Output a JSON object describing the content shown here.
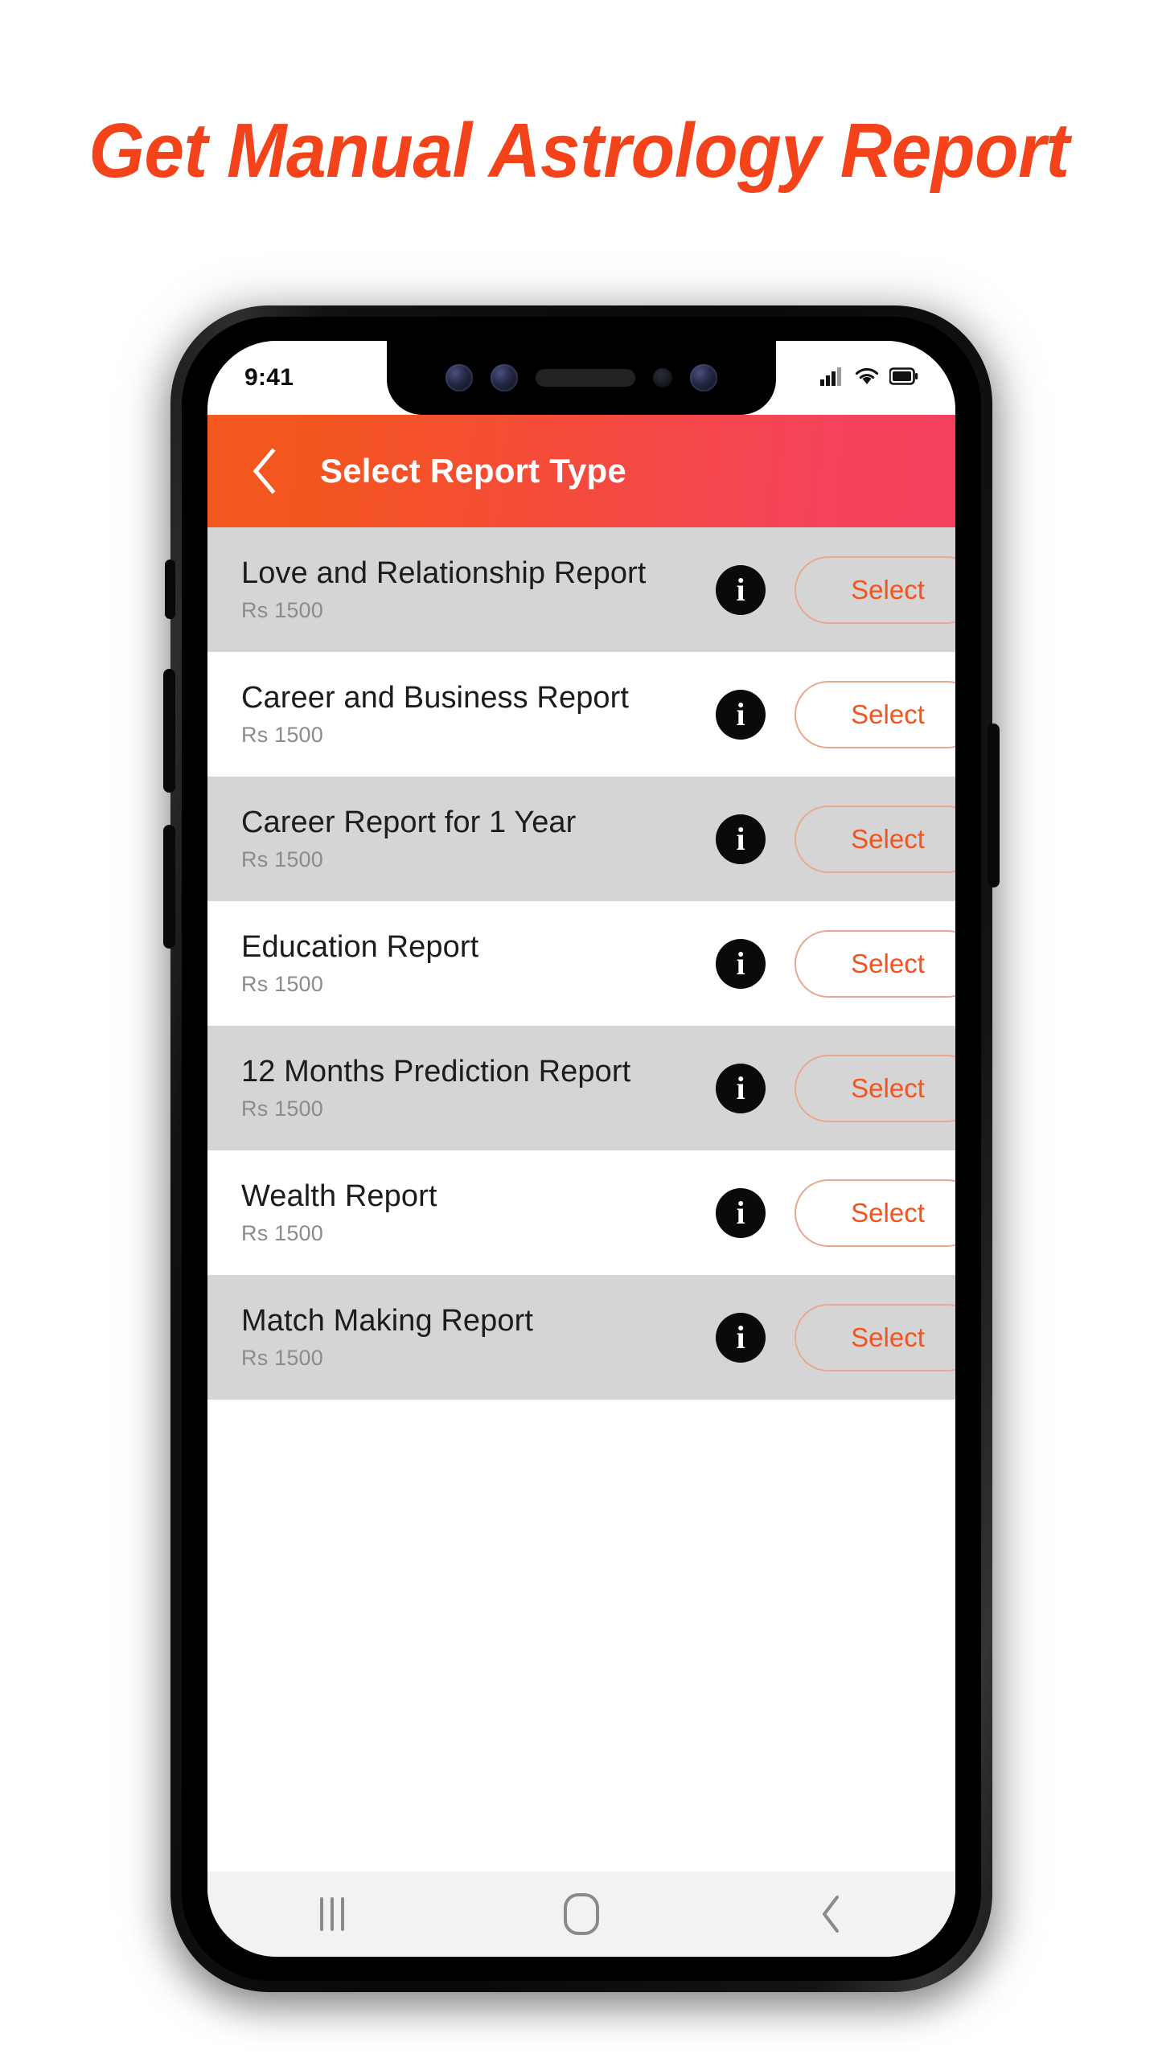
{
  "headline": "Get Manual Astrology Report",
  "colors": {
    "headline": "#F4431B",
    "header_gradient_start": "#F4591F",
    "header_gradient_end": "#F4405E",
    "accent": "#F4531F",
    "row_alt_bg": "#D5D5D5",
    "row_bg": "#FFFFFF",
    "info_icon_bg": "#0A0A0A",
    "price_text": "#8B8B8B"
  },
  "status_bar": {
    "time": "9:41",
    "icons": [
      "signal-icon",
      "wifi-icon",
      "battery-icon"
    ]
  },
  "app_header": {
    "back_icon": "chevron-left-icon",
    "title": "Select Report Type"
  },
  "reports": [
    {
      "title": "Love and Relationship Report",
      "price": "Rs 1500",
      "info": "i",
      "select_label": "Select"
    },
    {
      "title": "Career and Business Report",
      "price": "Rs 1500",
      "info": "i",
      "select_label": "Select"
    },
    {
      "title": "Career Report for 1 Year",
      "price": "Rs 1500",
      "info": "i",
      "select_label": "Select"
    },
    {
      "title": "Education Report",
      "price": "Rs 1500",
      "info": "i",
      "select_label": "Select"
    },
    {
      "title": "12 Months Prediction Report",
      "price": "Rs 1500",
      "info": "i",
      "select_label": "Select"
    },
    {
      "title": "Wealth Report",
      "price": "Rs 1500",
      "info": "i",
      "select_label": "Select"
    },
    {
      "title": "Match Making Report",
      "price": "Rs 1500",
      "info": "i",
      "select_label": "Select"
    }
  ],
  "nav_bar": {
    "recents": "recents-icon",
    "home": "home-icon",
    "back": "back-icon"
  }
}
